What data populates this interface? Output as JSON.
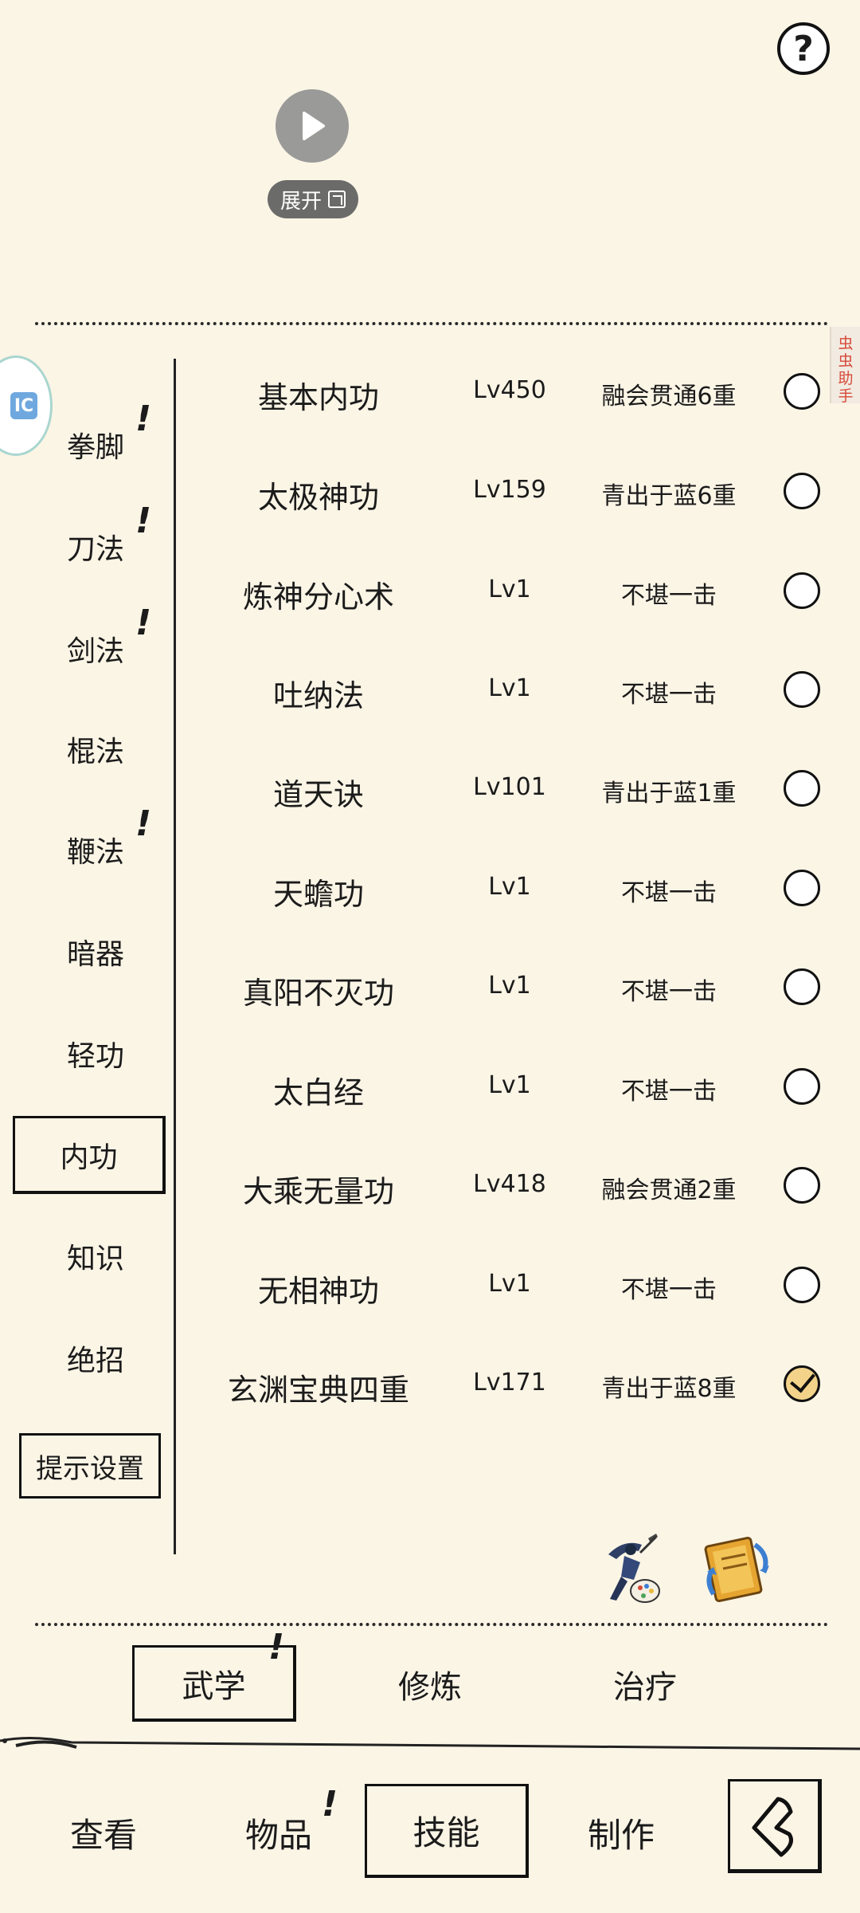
{
  "header": {
    "help_label": "?",
    "expand_label": "展开"
  },
  "helper_tag": "虫虫助手",
  "side_bubble_icon": "IC",
  "categories": [
    {
      "label": "拳脚",
      "alert": "!"
    },
    {
      "label": "刀法",
      "alert": "!"
    },
    {
      "label": "剑法",
      "alert": "!"
    },
    {
      "label": "棍法",
      "alert": ""
    },
    {
      "label": "鞭法",
      "alert": "!"
    },
    {
      "label": "暗器",
      "alert": ""
    },
    {
      "label": "轻功",
      "alert": ""
    },
    {
      "label": "内功",
      "alert": ""
    },
    {
      "label": "知识",
      "alert": ""
    },
    {
      "label": "绝招",
      "alert": ""
    }
  ],
  "active_category": "内功",
  "hint_settings_label": "提示设置",
  "skills": [
    {
      "name": "基本内功",
      "level": "Lv450",
      "state": "融会贯通6重",
      "selected": false
    },
    {
      "name": "太极神功",
      "level": "Lv159",
      "state": "青出于蓝6重",
      "selected": false
    },
    {
      "name": "炼神分心术",
      "level": "Lv1",
      "state": "不堪一击",
      "selected": false
    },
    {
      "name": "吐纳法",
      "level": "Lv1",
      "state": "不堪一击",
      "selected": false
    },
    {
      "name": "道天诀",
      "level": "Lv101",
      "state": "青出于蓝1重",
      "selected": false
    },
    {
      "name": "天蟾功",
      "level": "Lv1",
      "state": "不堪一击",
      "selected": false
    },
    {
      "name": "真阳不灭功",
      "level": "Lv1",
      "state": "不堪一击",
      "selected": false
    },
    {
      "name": "太白经",
      "level": "Lv1",
      "state": "不堪一击",
      "selected": false
    },
    {
      "name": "大乘无量功",
      "level": "Lv418",
      "state": "融会贯通2重",
      "selected": false
    },
    {
      "name": "无相神功",
      "level": "Lv1",
      "state": "不堪一击",
      "selected": false
    },
    {
      "name": "玄渊宝典四重",
      "level": "Lv171",
      "state": "青出于蓝8重",
      "selected": true
    }
  ],
  "sub_tabs": {
    "wuxue": "武学",
    "wuxue_alert": "!",
    "xiulian": "修炼",
    "zhiliao": "治疗"
  },
  "bottom_nav": {
    "view": "查看",
    "items": "物品",
    "items_alert": "!",
    "skills": "技能",
    "craft": "制作"
  }
}
